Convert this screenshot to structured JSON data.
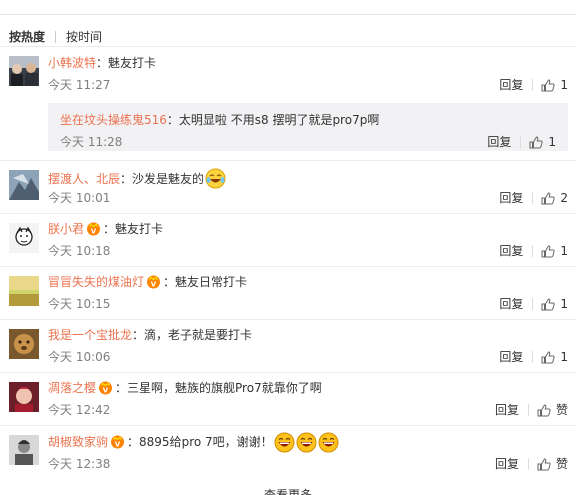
{
  "sort": {
    "hot": "按热度",
    "time": "按时间"
  },
  "like_label": "赞",
  "comments": [
    {
      "user": "小韩波特",
      "sep": "：",
      "text": "魅友打卡",
      "time": "今天 11:27",
      "reply": "回复",
      "likes": "1",
      "vip": false,
      "sub": {
        "user": "坐在坟头操练鬼516",
        "sep": "：",
        "text": "太明显啦  不用s8  摆明了就是pro7p啊",
        "time": "今天 11:28",
        "reply": "回复",
        "likes": "1"
      }
    },
    {
      "user": "摆渡人、北辰",
      "sep": "：",
      "text": "沙发是魅友的",
      "time": "今天 10:01",
      "reply": "回复",
      "likes": "2",
      "vip": false
    },
    {
      "user": "朕小君",
      "sep": "：",
      "text": "魅友打卡",
      "time": "今天 10:18",
      "reply": "回复",
      "likes": "1",
      "vip": true
    },
    {
      "user": "冒冒失失的煤油灯",
      "sep": "：",
      "text": "魅友日常打卡",
      "time": "今天 10:15",
      "reply": "回复",
      "likes": "1",
      "vip": true
    },
    {
      "user": "我是一个宝批龙",
      "sep": "：",
      "text": "滴，老子就是要打卡",
      "time": "今天 10:06",
      "reply": "回复",
      "likes": "1",
      "vip": false
    },
    {
      "user": "凋落之樱",
      "sep": "：",
      "text": "三星啊，魅族的旗舰Pro7就靠你了啊",
      "time": "今天 12:42",
      "reply": "回复",
      "likes": "赞",
      "vip": true
    },
    {
      "user": "胡椒致家驹",
      "sep": "：",
      "text": "8895给pro 7吧，谢谢！",
      "time": "今天 12:38",
      "reply": "回复",
      "likes": "赞",
      "vip": true
    }
  ],
  "more": "查看更多"
}
